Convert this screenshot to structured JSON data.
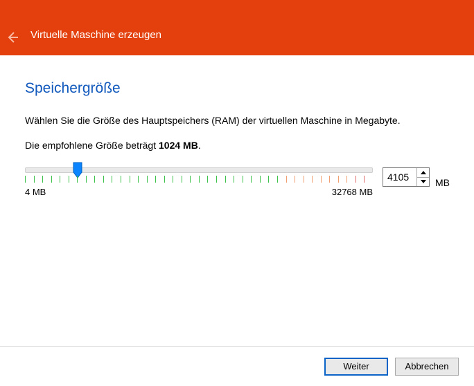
{
  "header": {
    "title": "Virtuelle Maschine erzeugen"
  },
  "page": {
    "heading": "Speichergröße",
    "description": "Wählen Sie die Größe des Hauptspeichers (RAM) der virtuellen Maschine in Megabyte.",
    "recommended_prefix": "Die empfohlene Größe beträgt ",
    "recommended_value": "1024 MB",
    "recommended_suffix": "."
  },
  "slider": {
    "min_label": "4 MB",
    "max_label": "32768 MB",
    "value": "4105",
    "unit": "MB"
  },
  "buttons": {
    "next": "Weiter",
    "cancel": "Abbrechen"
  }
}
